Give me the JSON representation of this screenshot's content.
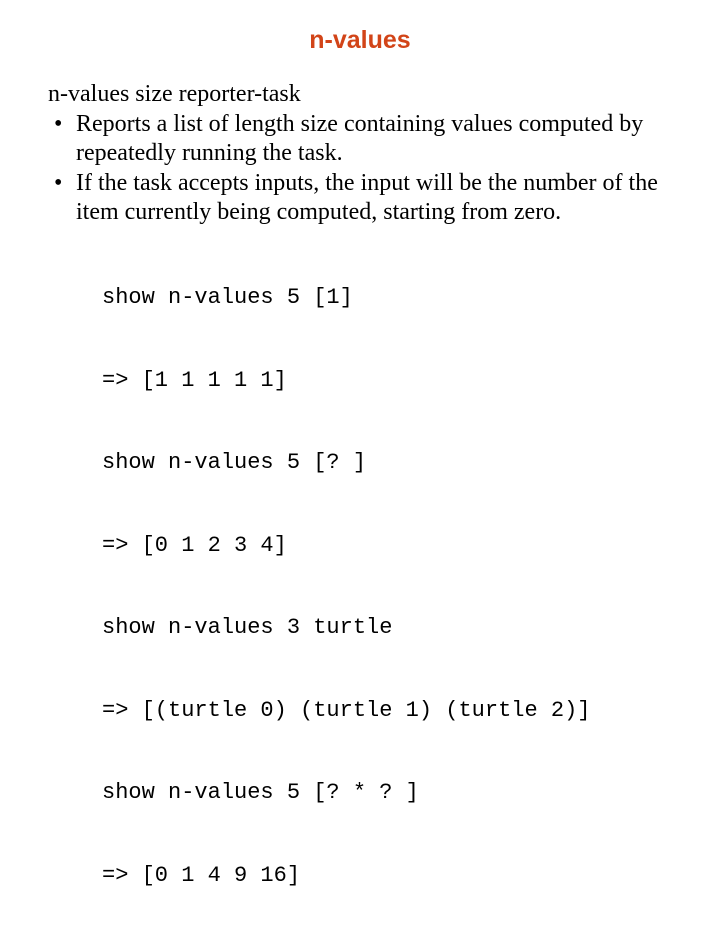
{
  "title": "n-values",
  "subtitle": "n-values size reporter-task",
  "bullets": [
    "Reports a list of length size containing values computed by repeatedly running the task.",
    "If the task accepts inputs, the input will be the number of the item currently being computed, starting from zero."
  ],
  "code": [
    "show n-values 5 [1]",
    "=> [1 1 1 1 1]",
    "show n-values 5 [? ]",
    "=> [0 1 2 3 4]",
    "show n-values 3 turtle",
    "=> [(turtle 0) (turtle 1) (turtle 2)]",
    "show n-values 5 [? * ? ]",
    "=> [0 1 4 9 16]"
  ]
}
